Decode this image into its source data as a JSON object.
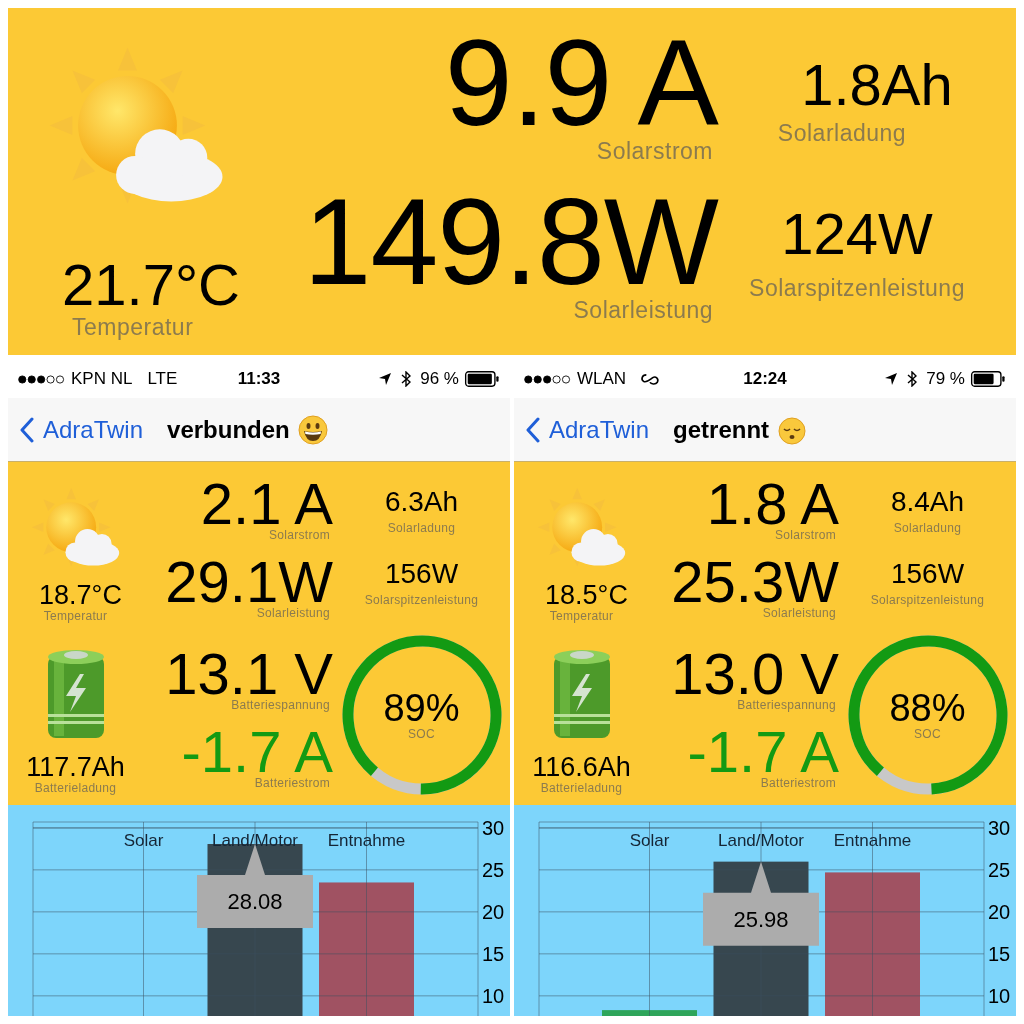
{
  "summary": {
    "temperature": {
      "value": "21.7°C",
      "label": "Temperatur"
    },
    "solar_current": {
      "value": "9.9 A",
      "label": "Solarstrom"
    },
    "solar_charge": {
      "value": "1.8Ah",
      "label": "Solarladung"
    },
    "solar_power": {
      "value": "149.8W",
      "label": "Solarleistung"
    },
    "peak_power": {
      "value": "124W",
      "label": "Solarspitzenleistung"
    }
  },
  "phones": [
    {
      "status_bar": {
        "carrier": "KPN NL",
        "network": "LTE",
        "link_icon": false,
        "time": "11:33",
        "battery": "96 %"
      },
      "nav": {
        "back": "AdraTwin",
        "title": "verbunden",
        "connected": true
      },
      "dashboard": {
        "solar_current": {
          "value": "2.1 A",
          "label": "Solarstrom"
        },
        "solar_charge": {
          "value": "6.3Ah",
          "label": "Solarladung"
        },
        "temperature": {
          "value": "18.7°C",
          "label": "Temperatur"
        },
        "solar_power": {
          "value": "29.1W",
          "label": "Solarleistung"
        },
        "peak_power": {
          "value": "156W",
          "label": "Solarspitzenleistung"
        },
        "battery_voltage": {
          "value": "13.1 V",
          "label": "Batteriespannung"
        },
        "battery_charge": {
          "value": "117.7Ah",
          "label": "Batterieladung"
        },
        "battery_current": {
          "value": "-1.7 A",
          "label": "Batteriestrom"
        },
        "soc": {
          "value": "89%",
          "label": "SOC"
        }
      },
      "chart_data": {
        "type": "bar",
        "grid": true,
        "series": [
          {
            "name": "Solar",
            "values": [
              null
            ]
          },
          {
            "name": "Land/Motor",
            "color": "#37474f",
            "values": [
              28.08
            ]
          },
          {
            "name": "Entnahme",
            "color": "#a05262",
            "values": [
              23.5
            ]
          }
        ],
        "ylim": [
          7.6,
          30.7
        ],
        "yticks": [
          10,
          15,
          20,
          25,
          30
        ],
        "annotations": [
          "28.08"
        ]
      }
    },
    {
      "status_bar": {
        "carrier": "WLAN",
        "link_icon": true,
        "time": "12:24",
        "battery": "79 %"
      },
      "nav": {
        "back": "AdraTwin",
        "title": "getrennt",
        "connected": false
      },
      "dashboard": {
        "solar_current": {
          "value": "1.8 A",
          "label": "Solarstrom"
        },
        "solar_charge": {
          "value": "8.4Ah",
          "label": "Solarladung"
        },
        "temperature": {
          "value": "18.5°C",
          "label": "Temperatur"
        },
        "solar_power": {
          "value": "25.3W",
          "label": "Solarleistung"
        },
        "peak_power": {
          "value": "156W",
          "label": "Solarspitzenleistung"
        },
        "battery_voltage": {
          "value": "13.0 V",
          "label": "Batteriespannung"
        },
        "battery_charge": {
          "value": "116.6Ah",
          "label": "Batterieladung"
        },
        "battery_current": {
          "value": "-1.7 A",
          "label": "Batteriestrom"
        },
        "soc": {
          "value": "88%",
          "label": "SOC"
        }
      },
      "chart_data": {
        "type": "bar",
        "grid": true,
        "series": [
          {
            "name": "Solar",
            "color": "#2ea55a",
            "values": [
              8.3
            ]
          },
          {
            "name": "Land/Motor",
            "color": "#37474f",
            "values": [
              25.98
            ]
          },
          {
            "name": "Entnahme",
            "color": "#a05262",
            "values": [
              24.7
            ]
          }
        ],
        "ylim": [
          7.6,
          30.7
        ],
        "yticks": [
          10,
          15,
          20,
          25,
          30
        ],
        "annotations": [
          "25.98"
        ]
      }
    }
  ]
}
